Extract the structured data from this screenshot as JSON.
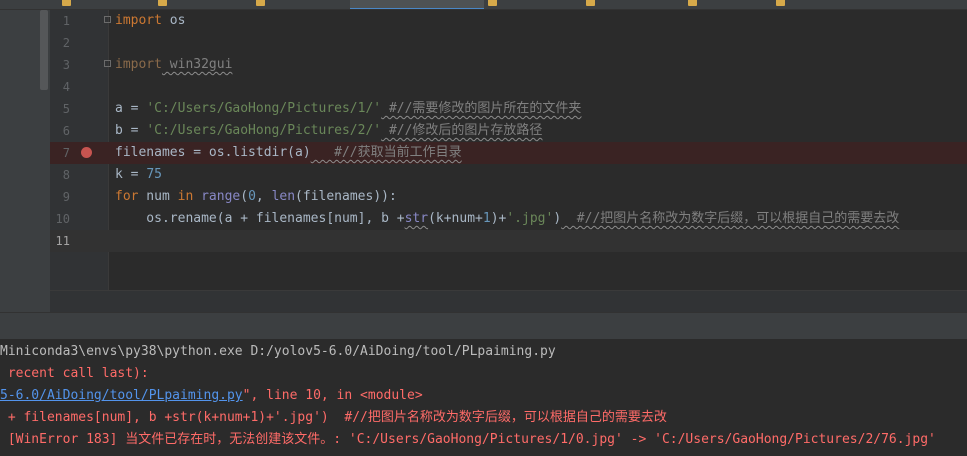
{
  "editor": {
    "line_numbers": [
      "1",
      "2",
      "3",
      "4",
      "5",
      "6",
      "7",
      "8",
      "9",
      "10",
      "11"
    ],
    "lines": {
      "l1": {
        "kw": "import",
        "rest": " os"
      },
      "l3": {
        "kw": "import",
        "rest": " win32gui"
      },
      "l5": {
        "pre": "a = ",
        "str": "'C:/Users/GaoHong/Pictures/1/'",
        "cmt": " #//需要修改的图片所在的文件夹"
      },
      "l6": {
        "pre": "b = ",
        "str": "'C:/Users/GaoHong/Pictures/2/'",
        "cmt": " #//修改后的图片存放路径"
      },
      "l7": {
        "pre": "filenames = os.listdir(a)",
        "cmt": "   #//获取当前工作目录"
      },
      "l8": {
        "pre": "k = ",
        "num": "75"
      },
      "l9": {
        "kw1": "for",
        "mid1": " num ",
        "kw2": "in",
        "sp": " ",
        "bi1": "range",
        "mid2": "(",
        "num0": "0",
        "mid3": ", ",
        "bi2": "len",
        "mid4": "(filenames)):"
      },
      "l10": {
        "pre": "    os.rename(a + filenames[num], b +",
        "bi": "str",
        "mid": "(k+num+",
        "num1": "1",
        "mid2": ")+",
        "str": "'.jpg'",
        "close": ")",
        "cmt": "  #//把图片名称改为数字后缀，可以根据自己的需要去改"
      }
    }
  },
  "console": {
    "line1": "Miniconda3\\envs\\py38\\python.exe D:/yolov5-6.0/AiDoing/tool/PLpaiming.py",
    "line2": " recent call last):",
    "line3_link": "5-6.0/AiDoing/tool/PLpaiming.py",
    "line3_rest": "\", line 10, in <module>",
    "line4": " + filenames[num], b +str(k+num+1)+'.jpg')  #//把图片名称改为数字后缀，可以根据自己的需要去改",
    "line5": " [WinError 183] 当文件已存在时，无法创建该文件。: 'C:/Users/GaoHong/Pictures/1/0.jpg' -> 'C:/Users/GaoHong/Pictures/2/76.jpg'"
  },
  "colors": {
    "background": "#2b2b2b",
    "keyword": "#cc7832",
    "string": "#6a8759",
    "number": "#6897bb",
    "comment": "#808080",
    "error": "#ff6b68",
    "breakpoint": "#c75450"
  },
  "icons": {
    "breakpoint": "breakpoint-icon",
    "fold": "fold-marker-icon"
  }
}
